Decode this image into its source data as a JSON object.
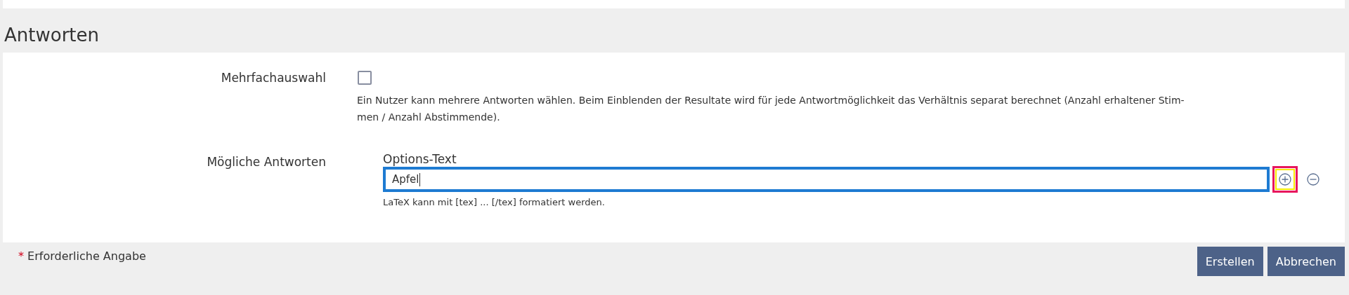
{
  "section_title": "Antworten",
  "fields": [
    {
      "kind": "checkbox",
      "label": "Mehrfachauswahl",
      "checked": false,
      "help": "Ein Nutzer kann mehrere Antworten wählen. Beim Einblenden der Resultate wird für jede Antwortmöglichkeit das Verhältnis separat berechnet (Anzahl erhaltener Stim-\nmen / Anzahl Abstimmende)."
    },
    {
      "kind": "options",
      "label": "Mögliche Antworten",
      "column_title": "Options-Text",
      "value": "Apfel",
      "focused": true,
      "help": "LaTeX kann mit [tex] ... [/tex] formatiert werden.",
      "add_highlighted": true
    }
  ],
  "required_note": {
    "mark": "*",
    "text": "Erforderliche Angabe"
  },
  "buttons": [
    "Erstellen",
    "Abbrechen"
  ]
}
